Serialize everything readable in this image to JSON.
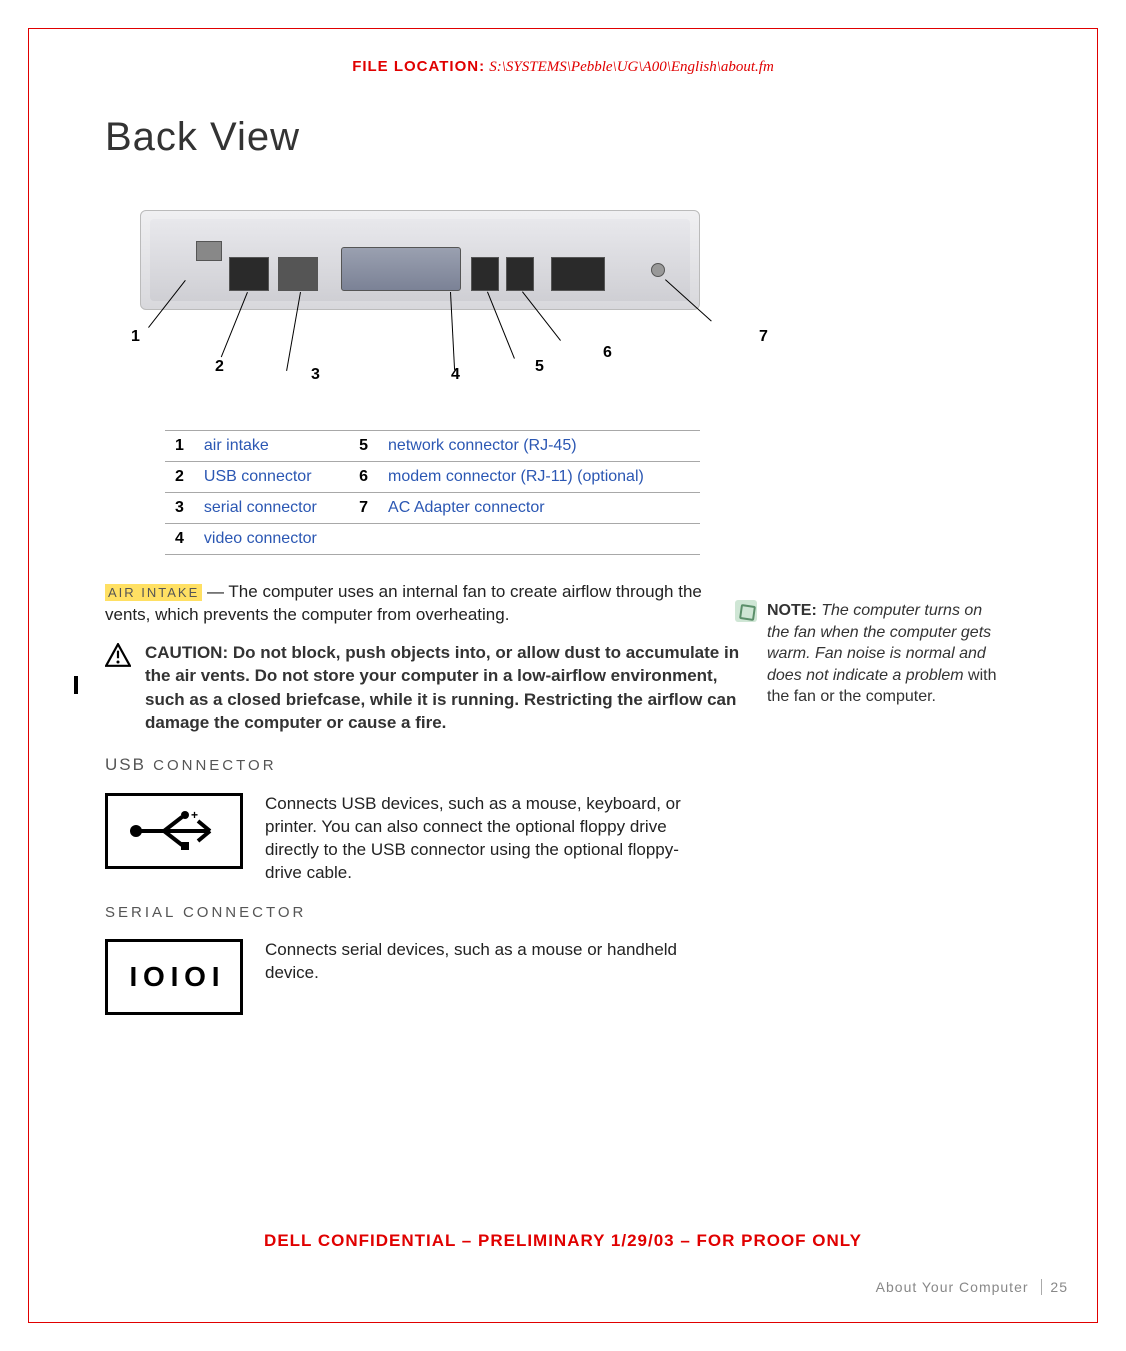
{
  "file_location": {
    "label": "FILE LOCATION:",
    "path": "S:\\SYSTEMS\\Pebble\\UG\\A00\\English\\about.fm"
  },
  "title": "Back View",
  "callouts": {
    "rows": [
      {
        "n1": "1",
        "t1": "air intake",
        "n2": "5",
        "t2": "network connector (RJ-45)"
      },
      {
        "n1": "2",
        "t1": "USB connector",
        "n2": "6",
        "t2": "modem connector (RJ-11) (optional)"
      },
      {
        "n1": "3",
        "t1": "serial connector",
        "n2": "7",
        "t2": "AC Adapter connector"
      },
      {
        "n1": "4",
        "t1": "video connector",
        "n2": "",
        "t2": ""
      }
    ]
  },
  "air_intake": {
    "label": "AIR INTAKE",
    "dash": " — ",
    "text": "The computer uses an internal fan to create airflow through the vents, which prevents the computer from overheating."
  },
  "caution": {
    "text": "CAUTION: Do not block, push objects into, or allow dust to accumulate in the air vents. Do not store your computer in a low-airflow environment, such as a closed briefcase, while it is running. Restricting the airflow can damage the computer or cause a fire."
  },
  "usb": {
    "heading_big": "USB",
    "heading_small": " CONNECTOR",
    "desc": "Connects USB devices, such as a mouse, keyboard, or printer. You can also connect the optional floppy drive directly to the USB connector using the optional floppy-drive cable."
  },
  "serial": {
    "heading": "SERIAL CONNECTOR",
    "desc": "Connects serial devices, such as a mouse or handheld device.",
    "glyph": "I O I O I"
  },
  "note": {
    "lead": "NOTE: ",
    "italic": "The computer turns on the fan when the computer gets warm. Fan noise is normal and does not indicate a problem",
    "rest": " with the fan or the computer."
  },
  "confidential": "DELL CONFIDENTIAL – PRELIMINARY 1/29/03 – FOR PROOF ONLY",
  "footer": {
    "section": "About Your Computer",
    "page": "25"
  }
}
